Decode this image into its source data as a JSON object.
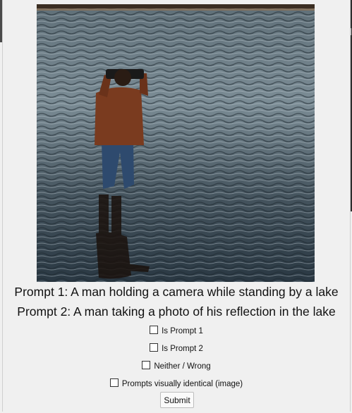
{
  "image": {
    "alt_icon": "photo-man-with-camera-in-lake"
  },
  "prompts": {
    "prompt1": "Prompt 1: A man holding a camera while standing by a lake",
    "prompt2": "Prompt 2: A man taking a photo of his reflection in the lake"
  },
  "options": [
    {
      "label": "Is Prompt 1",
      "checked": false
    },
    {
      "label": "Is Prompt 2",
      "checked": false
    },
    {
      "label": "Neither / Wrong",
      "checked": false
    },
    {
      "label": "Prompts visually identical (image)",
      "checked": false
    }
  ],
  "submit_label": "Submit"
}
